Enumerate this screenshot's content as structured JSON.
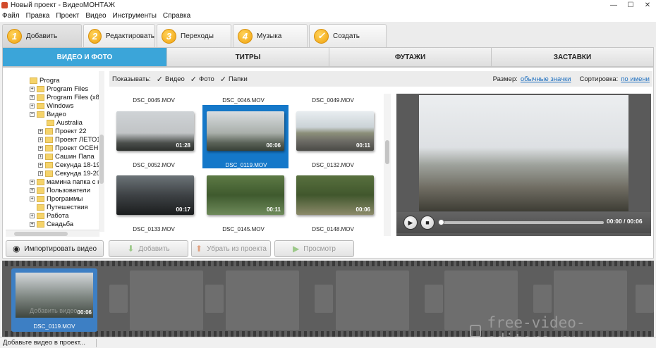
{
  "window": {
    "title": "Новый проект - ВидеоМОНТАЖ"
  },
  "menu": [
    "Файл",
    "Правка",
    "Проект",
    "Видео",
    "Инструменты",
    "Справка"
  ],
  "steps": [
    {
      "num": "1",
      "label": "Добавить"
    },
    {
      "num": "2",
      "label": "Редактировать"
    },
    {
      "num": "3",
      "label": "Переходы"
    },
    {
      "num": "4",
      "label": "Музыка"
    },
    {
      "num": "✓",
      "label": "Создать"
    }
  ],
  "subtabs": [
    "ВИДЕО И ФОТО",
    "ТИТРЫ",
    "ФУТАЖИ",
    "ЗАСТАВКИ"
  ],
  "tree": [
    {
      "label": "Progra",
      "expander": ""
    },
    {
      "label": "Program Files",
      "expander": "+"
    },
    {
      "label": "Program Files (x8",
      "expander": "+"
    },
    {
      "label": "Windows",
      "expander": "+"
    },
    {
      "label": "Видео",
      "expander": "−"
    },
    {
      "label": "Australia",
      "expander": ""
    },
    {
      "label": "Проект 22",
      "expander": "+"
    },
    {
      "label": "Проект ЛЕТО1",
      "expander": "+"
    },
    {
      "label": "Проект ОСЕНЬ",
      "expander": "+"
    },
    {
      "label": "Сашин Папа",
      "expander": "+"
    },
    {
      "label": "Секунда 18-19",
      "expander": "+"
    },
    {
      "label": "Секунда 19-20",
      "expander": "+"
    },
    {
      "label": "мамина папка с к",
      "expander": "+"
    },
    {
      "label": "Пользователи",
      "expander": "+"
    },
    {
      "label": "Программы",
      "expander": "+"
    },
    {
      "label": "Путешествия",
      "expander": ""
    },
    {
      "label": "Работа",
      "expander": "+"
    },
    {
      "label": "Свадьба",
      "expander": "+"
    }
  ],
  "filter": {
    "show_label": "Показывать:",
    "video": "Видео",
    "photo": "Фото",
    "folders": "Папки",
    "check": "✓",
    "size_label": "Размер:",
    "size_value": "обычные значки",
    "sort_label": "Сортировка:",
    "sort_value": "по имени"
  },
  "files": {
    "top_labels": [
      "DSC_0045.MOV",
      "DSC_0046.MOV",
      "DSC_0049.MOV"
    ],
    "row1": [
      {
        "name": "DSC_0052.MOV",
        "duration": "01:28"
      },
      {
        "name": "DSC_0119.MOV",
        "duration": "00:06",
        "selected": true
      },
      {
        "name": "DSC_0132.MOV",
        "duration": "00:11"
      }
    ],
    "row2": [
      {
        "name": "DSC_0133.MOV",
        "duration": "00:17"
      },
      {
        "name": "DSC_0145.MOV",
        "duration": "00:11"
      },
      {
        "name": "DSC_0148.MOV",
        "duration": "00:06"
      }
    ]
  },
  "player": {
    "time": "00:00 / 00:06",
    "progress": 0
  },
  "buttons": {
    "import": "Импортировать видео",
    "add": "Добавить",
    "remove": "Убрать из проекта",
    "preview": "Просмотр"
  },
  "timeline": {
    "clip_name": "DSC_0119.MOV",
    "clip_duration": "00:06",
    "hint": "Добавить видео"
  },
  "watermark": "free-video-editors.ru",
  "status": "Добавьте видео в проект..."
}
